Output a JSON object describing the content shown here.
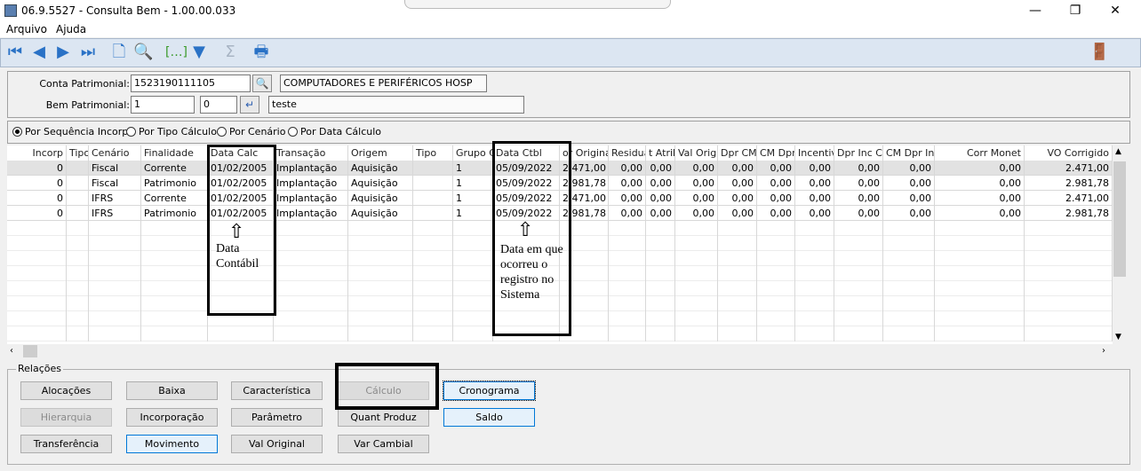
{
  "window": {
    "title": "06.9.5527 - Consulta Bem - 1.00.00.033",
    "minimize": "—",
    "maximize": "❐",
    "close": "✕"
  },
  "menu": [
    "Arquivo",
    "Ajuda"
  ],
  "toolbar": {
    "icons": [
      "first-icon",
      "previous-icon",
      "next-icon",
      "last-icon",
      "new-document-icon",
      "preview-icon",
      "ellipsis-bracket-icon",
      "filter-icon",
      "sum-icon",
      "print-icon"
    ],
    "exit_icon": "exit-door-icon"
  },
  "form": {
    "conta_label": "Conta Patrimonial:",
    "conta_value": "1523190111105",
    "conta_desc": "COMPUTADORES E PERIFÉRICOS HOSP",
    "bem_label": "Bem Patrimonial:",
    "bem_value": "1",
    "bem_seq": "0",
    "bem_desc": "teste"
  },
  "order_options": [
    {
      "label": "Por Sequência Incorp",
      "selected": true
    },
    {
      "label": "Por Tipo Cálculo",
      "selected": false
    },
    {
      "label": "Por Cenário",
      "selected": false
    },
    {
      "label": "Por Data Cálculo",
      "selected": false
    }
  ],
  "grid": {
    "columns": [
      "Incorp",
      "Tipo",
      "Cenário",
      "Finalidade",
      "Data Calc",
      "Transação",
      "Origem",
      "Tipo",
      "Grupo Ca",
      "Data Ctbl",
      "or Original",
      "Residual",
      "t Atrib",
      "Val Orig",
      "Dpr CM",
      "CM Dpr",
      "Incentiv",
      "Dpr Inc CM",
      "CM Dpr Inc",
      "Corr Monet",
      "VO Corrigido"
    ],
    "rows": [
      [
        "0",
        "",
        "Fiscal",
        "Corrente",
        "01/02/2005",
        "Implantação",
        "Aquisição",
        "",
        "1",
        "05/09/2022",
        "2.471,00",
        "0,00",
        "0,00",
        "0,00",
        "0,00",
        "0,00",
        "0,00",
        "0,00",
        "0,00",
        "0,00",
        "2.471,00"
      ],
      [
        "0",
        "",
        "Fiscal",
        "Patrimonio",
        "01/02/2005",
        "Implantação",
        "Aquisição",
        "",
        "1",
        "05/09/2022",
        "2.981,78",
        "0,00",
        "0,00",
        "0,00",
        "0,00",
        "0,00",
        "0,00",
        "0,00",
        "0,00",
        "0,00",
        "2.981,78"
      ],
      [
        "0",
        "",
        "IFRS",
        "Corrente",
        "01/02/2005",
        "Implantação",
        "Aquisição",
        "",
        "1",
        "05/09/2022",
        "2.471,00",
        "0,00",
        "0,00",
        "0,00",
        "0,00",
        "0,00",
        "0,00",
        "0,00",
        "0,00",
        "0,00",
        "2.471,00"
      ],
      [
        "0",
        "",
        "IFRS",
        "Patrimonio",
        "01/02/2005",
        "Implantação",
        "Aquisição",
        "",
        "1",
        "05/09/2022",
        "2.981,78",
        "0,00",
        "0,00",
        "0,00",
        "0,00",
        "0,00",
        "0,00",
        "0,00",
        "0,00",
        "0,00",
        "2.981,78"
      ]
    ],
    "selected_row": 0
  },
  "relations": {
    "label": "Relações",
    "buttons": [
      {
        "label": "Alocações",
        "state": "normal"
      },
      {
        "label": "Baixa",
        "state": "normal"
      },
      {
        "label": "Característica",
        "state": "normal"
      },
      {
        "label": "Cálculo",
        "state": "disabled"
      },
      {
        "label": "Cronograma",
        "state": "focused"
      },
      {
        "label": "Hierarquia",
        "state": "disabled"
      },
      {
        "label": "Incorporação",
        "state": "normal"
      },
      {
        "label": "Parâmetro",
        "state": "normal"
      },
      {
        "label": "Quant Produz",
        "state": "normal"
      },
      {
        "label": "Saldo",
        "state": "highlight"
      },
      {
        "label": "Transferência",
        "state": "normal"
      },
      {
        "label": "Movimento",
        "state": "highlight"
      },
      {
        "label": "Val Original",
        "state": "normal"
      },
      {
        "label": "Var Cambial",
        "state": "normal"
      }
    ]
  },
  "annotations": {
    "data_calc": "Data Contábil",
    "data_ctbl": "Data em que ocorreu o registro no Sistema",
    "arrow": "⇧"
  }
}
